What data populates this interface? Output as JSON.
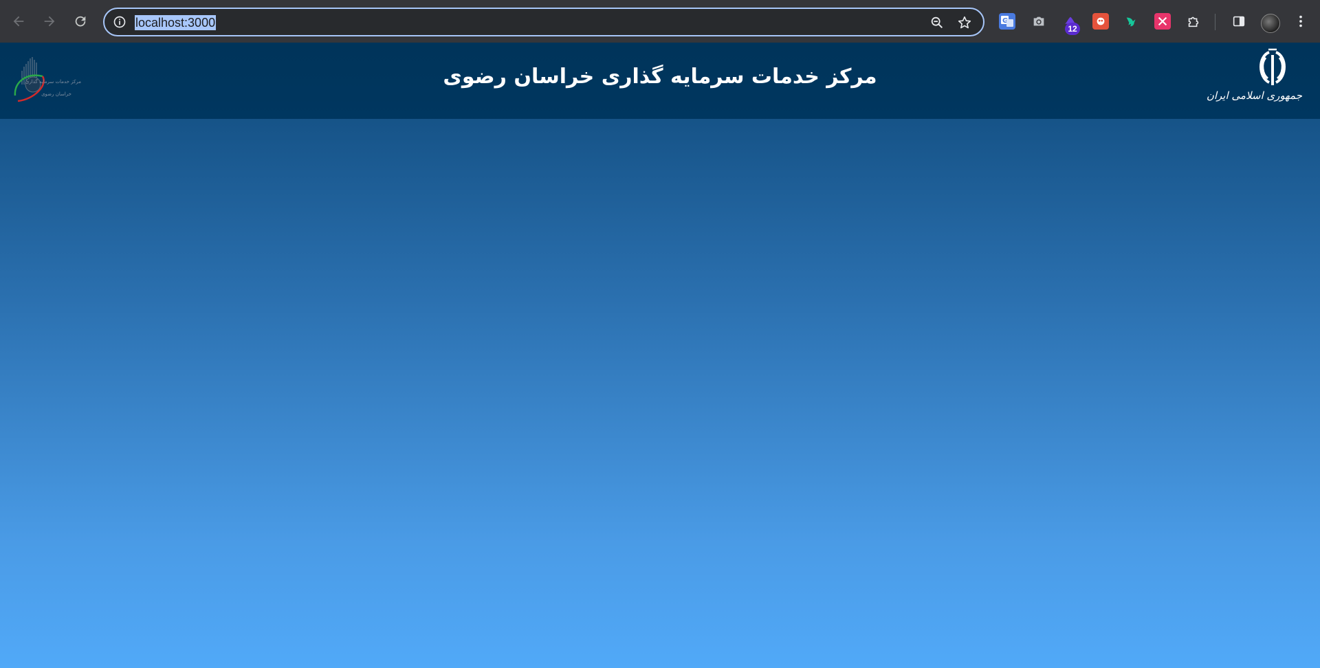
{
  "browser": {
    "url": "localhost:3000",
    "extension_badge": "12",
    "icons": {
      "back": "arrow-left-icon",
      "forward": "arrow-right-icon",
      "reload": "reload-icon",
      "site_info": "info-icon",
      "zoom": "zoom-out-icon",
      "bookmark": "star-icon",
      "extensions": "puzzle-icon",
      "side_panel": "side-panel-icon",
      "menu": "kebab-menu-icon"
    }
  },
  "header": {
    "title": "مرکز خدمات سرمایه گذاری خراسان رضوی",
    "left_logo_line1": "مرکز خدمات سرمایه گذاری",
    "left_logo_line2": "خراسان رضوی",
    "right_emblem_caption": "جمهوری اسلامی ایران"
  },
  "colors": {
    "header_bg": "#00345a",
    "page_gradient_top": "#0d4777",
    "page_gradient_bottom": "#51a9f8",
    "url_highlight": "#a8c7fa"
  }
}
